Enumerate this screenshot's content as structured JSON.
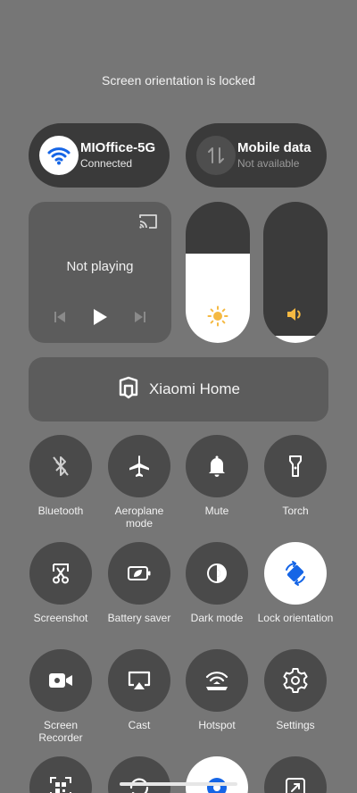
{
  "toast": "Screen orientation is locked",
  "wifi": {
    "name": "MIOffice-5G",
    "status": "Connected",
    "icon": "wifi-icon"
  },
  "mobile": {
    "name": "Mobile data",
    "status": "Not available",
    "icon": "mobile-data-icon"
  },
  "media": {
    "status": "Not playing"
  },
  "brightness": {
    "level": 0.63,
    "icon": "sun-icon"
  },
  "volume": {
    "level": 0.05,
    "icon": "speaker-icon"
  },
  "home": {
    "label": "Xiaomi Home"
  },
  "tiles": [
    {
      "label": "Bluetooth"
    },
    {
      "label": "Aeroplane mode"
    },
    {
      "label": "Mute"
    },
    {
      "label": "Torch"
    },
    {
      "label": "Screenshot"
    },
    {
      "label": "Battery saver"
    },
    {
      "label": "Dark mode"
    },
    {
      "label": "Lock orientation"
    },
    {
      "label": "Screen Recorder"
    },
    {
      "label": "Cast"
    },
    {
      "label": "Hotspot"
    },
    {
      "label": "Settings"
    }
  ],
  "colors": {
    "accent": "#1565e6",
    "panel": "#3a3a3a",
    "tile": "#4a4a4a",
    "sun": "#f5b942",
    "active": "#ffffff"
  }
}
